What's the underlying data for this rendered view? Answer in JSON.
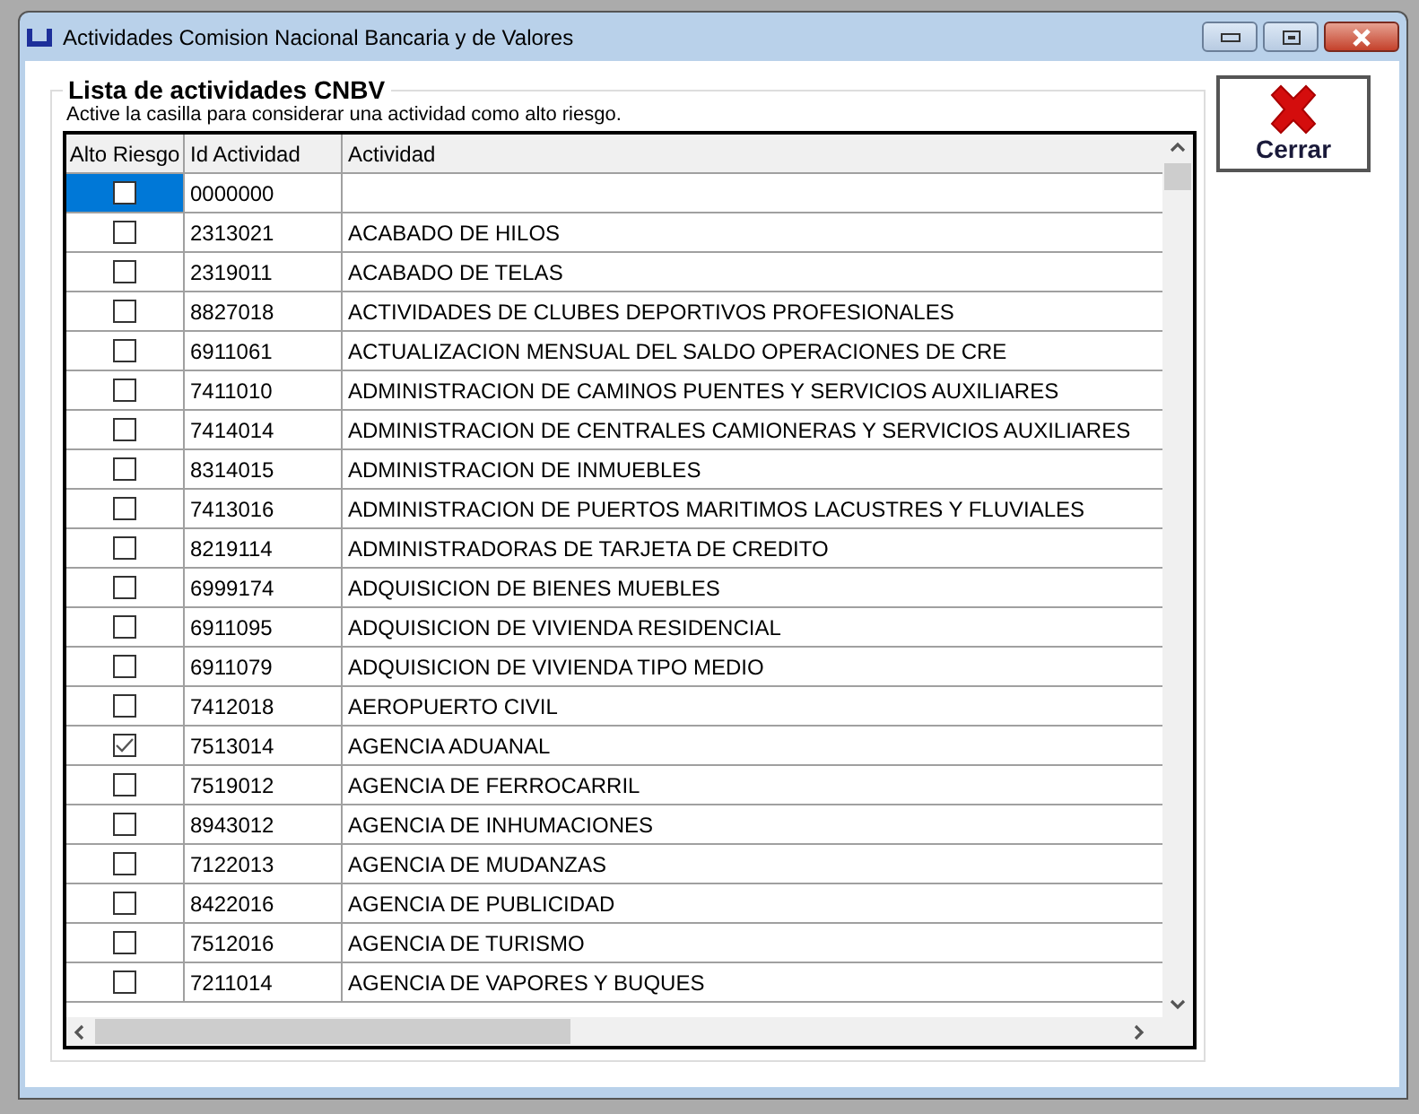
{
  "window": {
    "title": "Actividades Comision Nacional Bancaria y de Valores"
  },
  "group": {
    "title": "Lista de actividades CNBV",
    "hint": "Active la casilla para considerar una actividad como alto riesgo."
  },
  "table": {
    "columns": [
      "Alto Riesgo",
      "Id Actividad",
      "Actividad"
    ],
    "rows": [
      {
        "checked": false,
        "selected": true,
        "id": "0000000"
      },
      {
        "checked": false,
        "selected": false,
        "id": "2313021",
        "activity": "ACABADO DE HILOS"
      },
      {
        "checked": false,
        "selected": false,
        "id": "2319011",
        "activity": "ACABADO DE TELAS"
      },
      {
        "checked": false,
        "selected": false,
        "id": "8827018",
        "activity": "ACTIVIDADES DE CLUBES DEPORTIVOS PROFESIONALES"
      },
      {
        "checked": false,
        "selected": false,
        "id": "6911061",
        "activity": "ACTUALIZACION MENSUAL DEL SALDO OPERACIONES DE CRE"
      },
      {
        "checked": false,
        "selected": false,
        "id": "7411010",
        "activity": "ADMINISTRACION DE CAMINOS PUENTES Y SERVICIOS AUXILIARES"
      },
      {
        "checked": false,
        "selected": false,
        "id": "7414014",
        "activity": "ADMINISTRACION DE CENTRALES CAMIONERAS Y SERVICIOS AUXILIARES"
      },
      {
        "checked": false,
        "selected": false,
        "id": "8314015",
        "activity": "ADMINISTRACION DE INMUEBLES"
      },
      {
        "checked": false,
        "selected": false,
        "id": "7413016",
        "activity": "ADMINISTRACION DE PUERTOS MARITIMOS LACUSTRES Y FLUVIALES"
      },
      {
        "checked": false,
        "selected": false,
        "id": "8219114",
        "activity": "ADMINISTRADORAS DE TARJETA DE CREDITO"
      },
      {
        "checked": false,
        "selected": false,
        "id": "6999174",
        "activity": "ADQUISICION DE BIENES MUEBLES"
      },
      {
        "checked": false,
        "selected": false,
        "id": "6911095",
        "activity": "ADQUISICION DE VIVIENDA RESIDENCIAL"
      },
      {
        "checked": false,
        "selected": false,
        "id": "6911079",
        "activity": "ADQUISICION DE VIVIENDA TIPO MEDIO"
      },
      {
        "checked": false,
        "selected": false,
        "id": "7412018",
        "activity": "AEROPUERTO CIVIL"
      },
      {
        "checked": true,
        "selected": false,
        "id": "7513014",
        "activity": "AGENCIA ADUANAL"
      },
      {
        "checked": false,
        "selected": false,
        "id": "7519012",
        "activity": "AGENCIA DE FERROCARRIL"
      },
      {
        "checked": false,
        "selected": false,
        "id": "8943012",
        "activity": "AGENCIA DE INHUMACIONES"
      },
      {
        "checked": false,
        "selected": false,
        "id": "7122013",
        "activity": "AGENCIA DE MUDANZAS"
      },
      {
        "checked": false,
        "selected": false,
        "id": "8422016",
        "activity": "AGENCIA DE PUBLICIDAD"
      },
      {
        "checked": false,
        "selected": false,
        "id": "7512016",
        "activity": "AGENCIA DE TURISMO"
      },
      {
        "checked": false,
        "selected": false,
        "id": "7211014",
        "activity": "AGENCIA DE VAPORES Y BUQUES"
      }
    ]
  },
  "close_button": {
    "label": "Cerrar"
  }
}
